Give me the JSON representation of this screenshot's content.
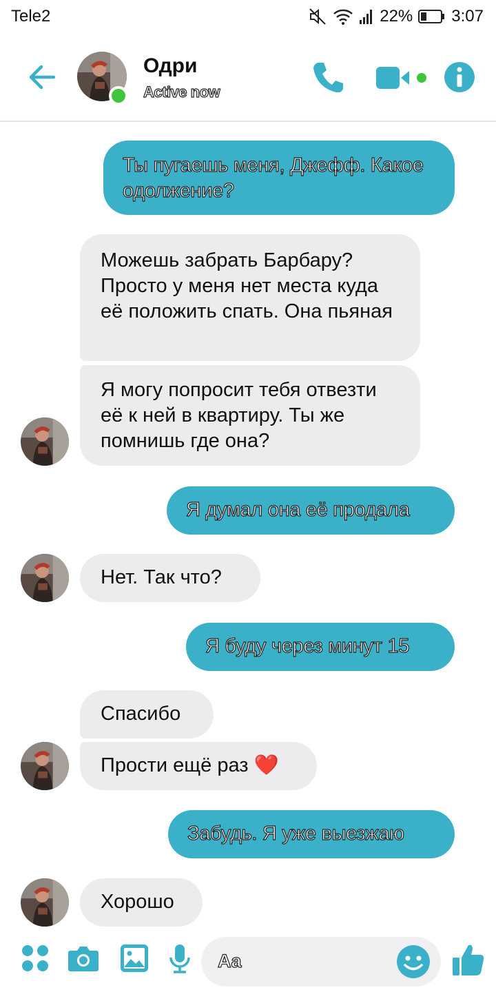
{
  "status_bar": {
    "carrier": "Tele2",
    "battery": "22%",
    "time": "3:07"
  },
  "header": {
    "name": "Одри",
    "status": "Active now"
  },
  "messages": [
    {
      "side": "out",
      "text": "Ты пугаешь меня, Джефф. Какое одолжение?"
    },
    {
      "side": "in",
      "text": "Можешь забрать Барбару? Просто у меня нет места куда её положить спать. Она пьяная"
    },
    {
      "side": "in",
      "text": "Я могу попросит тебя отвезти её к ней в квартиру. Ты же помнишь где она?"
    },
    {
      "side": "out",
      "text": "Я думал она её продала"
    },
    {
      "side": "in",
      "text": "Нет. Так что?"
    },
    {
      "side": "out",
      "text": "Я буду через минут 15"
    },
    {
      "side": "in",
      "text": "Спасибо"
    },
    {
      "side": "in",
      "text": "Прости ещё раз ❤️"
    },
    {
      "side": "out",
      "text": "Забудь. Я уже выезжаю"
    },
    {
      "side": "in",
      "text": "Хорошо"
    }
  ],
  "composer": {
    "placeholder": "Aa"
  },
  "colors": {
    "accent": "#3ab0c9",
    "incoming_bubble": "#ececef",
    "online": "#3fc43b"
  }
}
